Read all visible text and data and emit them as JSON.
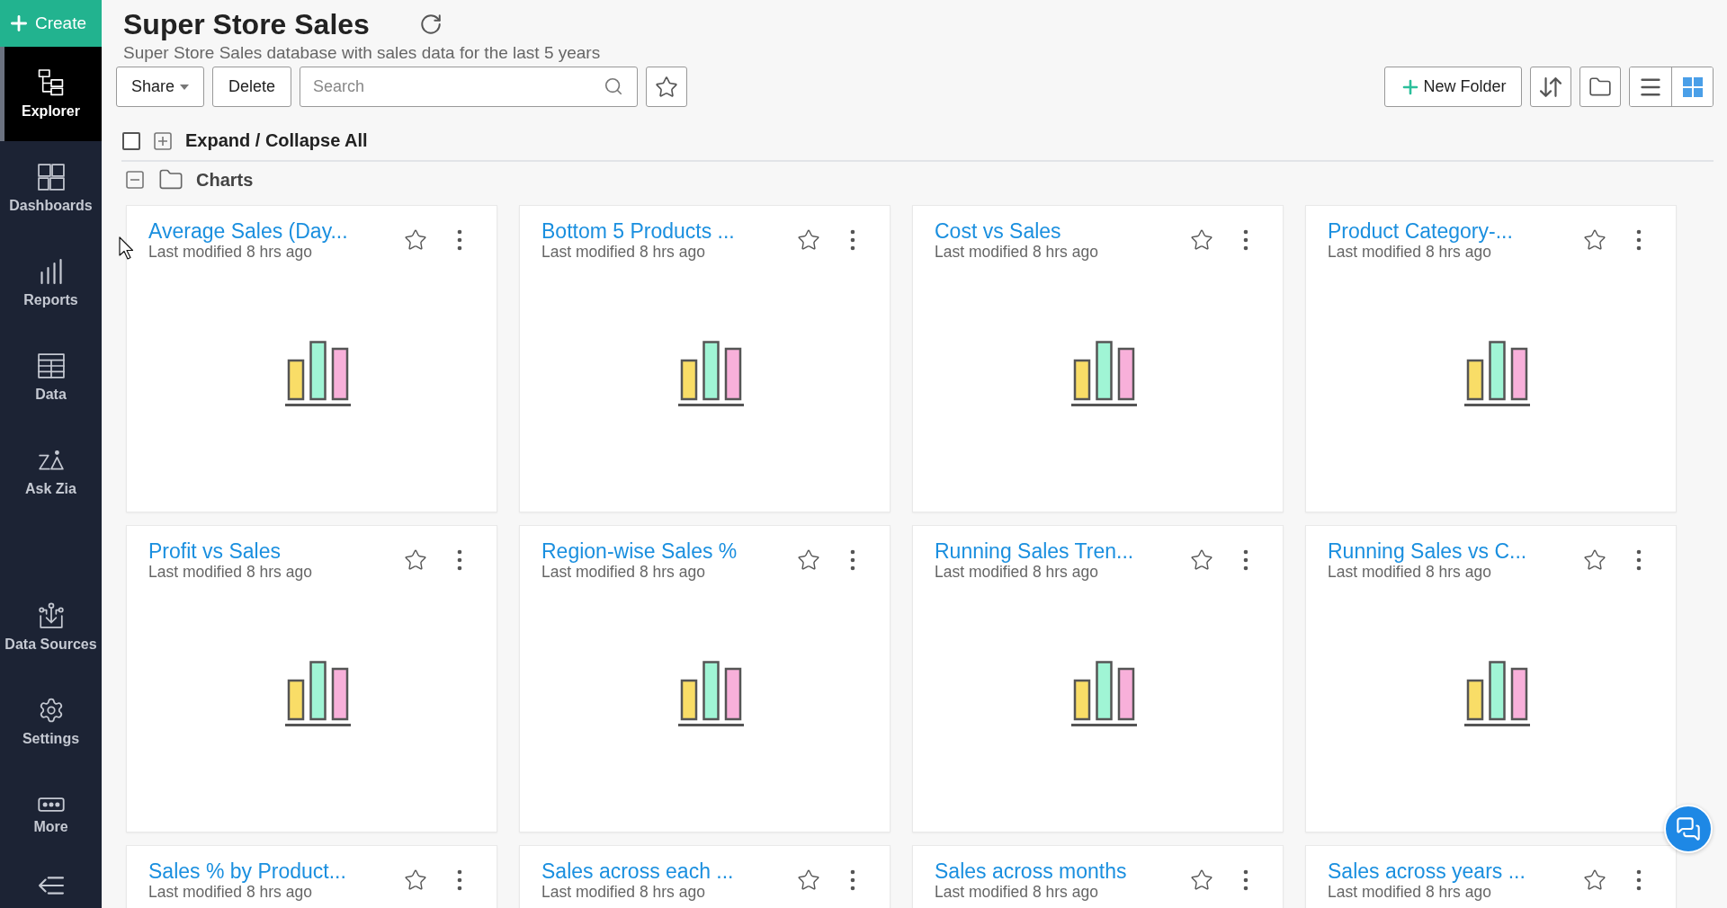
{
  "sidebar": {
    "create_button": {
      "label": "Create"
    },
    "items": [
      {
        "label": "Explorer",
        "selected": true
      },
      {
        "label": "Dashboards",
        "selected": false
      },
      {
        "label": "Reports",
        "selected": false
      },
      {
        "label": "Data",
        "selected": false
      },
      {
        "label": "Ask Zia",
        "selected": false
      }
    ],
    "bottom_items": [
      {
        "label": "Data Sources",
        "selected": false
      },
      {
        "label": "Settings",
        "selected": false
      },
      {
        "label": "More",
        "selected": false
      }
    ]
  },
  "header": {
    "title": "Super Store Sales",
    "description": "Super Store Sales database with sales data for the last 5 years"
  },
  "toolbar": {
    "share_button": {
      "label": "Share"
    },
    "delete_button": {
      "label": "Delete"
    },
    "search": {
      "placeholder": "Search"
    },
    "new_folder_button": {
      "label": "New Folder"
    },
    "view_modes": [
      {
        "kind": "list",
        "selected": false
      },
      {
        "kind": "grid",
        "selected": true
      }
    ]
  },
  "expand_all": {
    "label": "Expand / Collapse All",
    "checked": false
  },
  "folder": {
    "name": "Charts",
    "expanded": true,
    "items": [
      {
        "title": "Average Sales (Day...",
        "subtitle": "Last modified 8 hrs ago",
        "starred": false
      },
      {
        "title": "Bottom 5 Products ...",
        "subtitle": "Last modified 8 hrs ago",
        "starred": false
      },
      {
        "title": "Cost vs Sales",
        "subtitle": "Last modified 8 hrs ago",
        "starred": false
      },
      {
        "title": "Product Category-...",
        "subtitle": "Last modified 8 hrs ago",
        "starred": false
      },
      {
        "title": "Profit vs Sales",
        "subtitle": "Last modified 8 hrs ago",
        "starred": false
      },
      {
        "title": "Region-wise Sales %",
        "subtitle": "Last modified 8 hrs ago",
        "starred": false
      },
      {
        "title": "Running Sales Tren...",
        "subtitle": "Last modified 8 hrs ago",
        "starred": false
      },
      {
        "title": "Running Sales vs C...",
        "subtitle": "Last modified 8 hrs ago",
        "starred": false
      },
      {
        "title": "Sales % by Product...",
        "subtitle": "Last modified 8 hrs ago",
        "starred": false
      },
      {
        "title": "Sales across each ...",
        "subtitle": "Last modified 8 hrs ago",
        "starred": false
      },
      {
        "title": "Sales across months",
        "subtitle": "Last modified 8 hrs ago",
        "starred": false
      },
      {
        "title": "Sales across years ...",
        "subtitle": "Last modified 8 hrs ago",
        "starred": false
      }
    ]
  }
}
